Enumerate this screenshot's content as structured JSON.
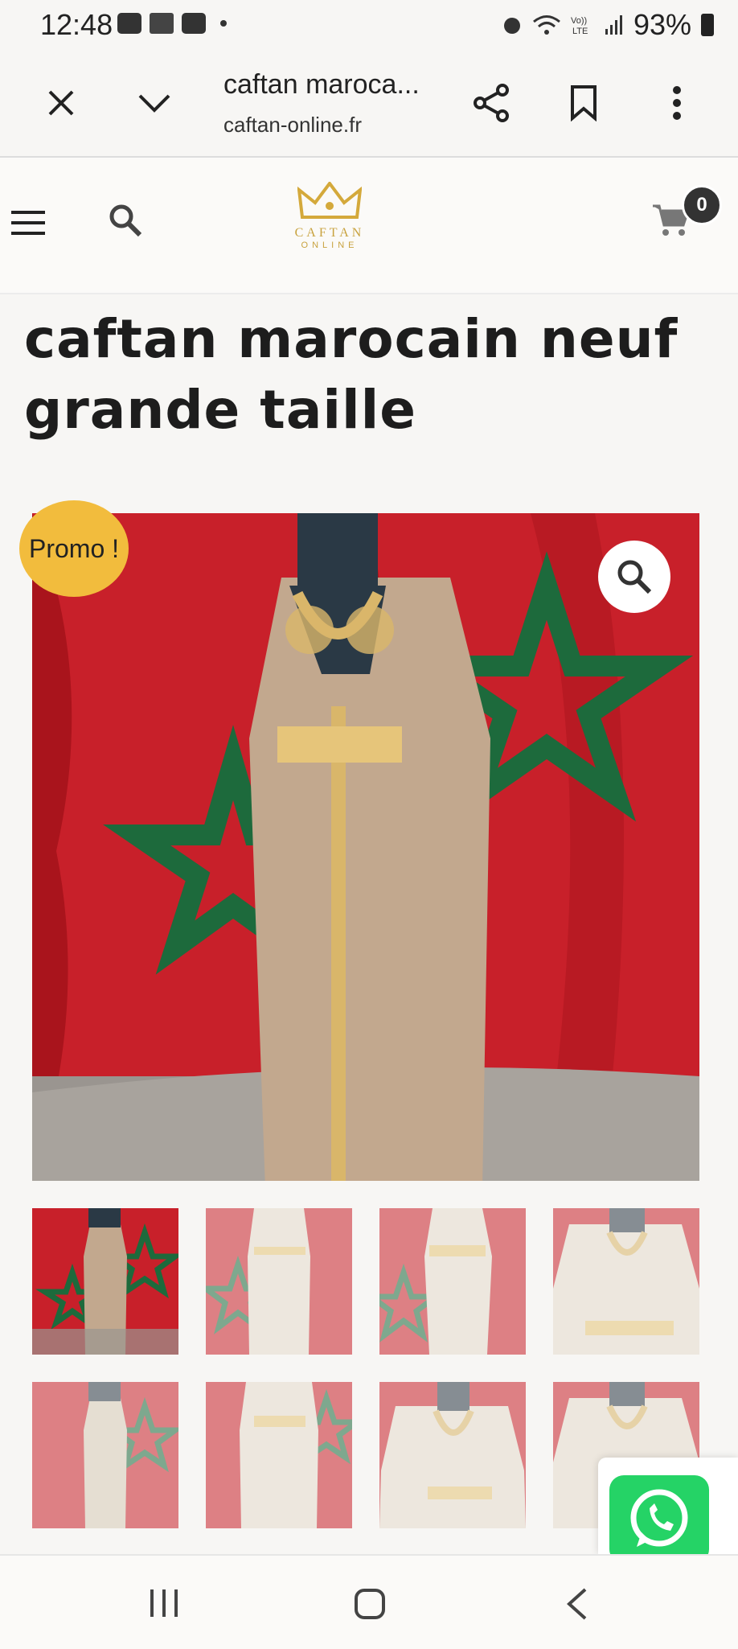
{
  "status_bar": {
    "time": "12:48",
    "battery": "93%"
  },
  "browser": {
    "title": "caftan maroca...",
    "url": "caftan-online.fr"
  },
  "site": {
    "logo_name": "CAFTAN",
    "logo_sub": "ONLINE",
    "cart_count": "0"
  },
  "product": {
    "title": "caftan marocain neuf grande taille",
    "promo_label": "Promo !"
  },
  "colors": {
    "promo": "#f2bc3d",
    "brand_gold": "#c8a23e",
    "flag_red": "#c8202a",
    "flag_green": "#1d6a3c",
    "whatsapp": "#25d366"
  },
  "icons": [
    "close-icon",
    "chevron-down-icon",
    "share-icon",
    "bookmark-icon",
    "more-vert-icon",
    "menu-icon",
    "search-icon",
    "cart-icon",
    "zoom-icon",
    "whatsapp-icon"
  ]
}
